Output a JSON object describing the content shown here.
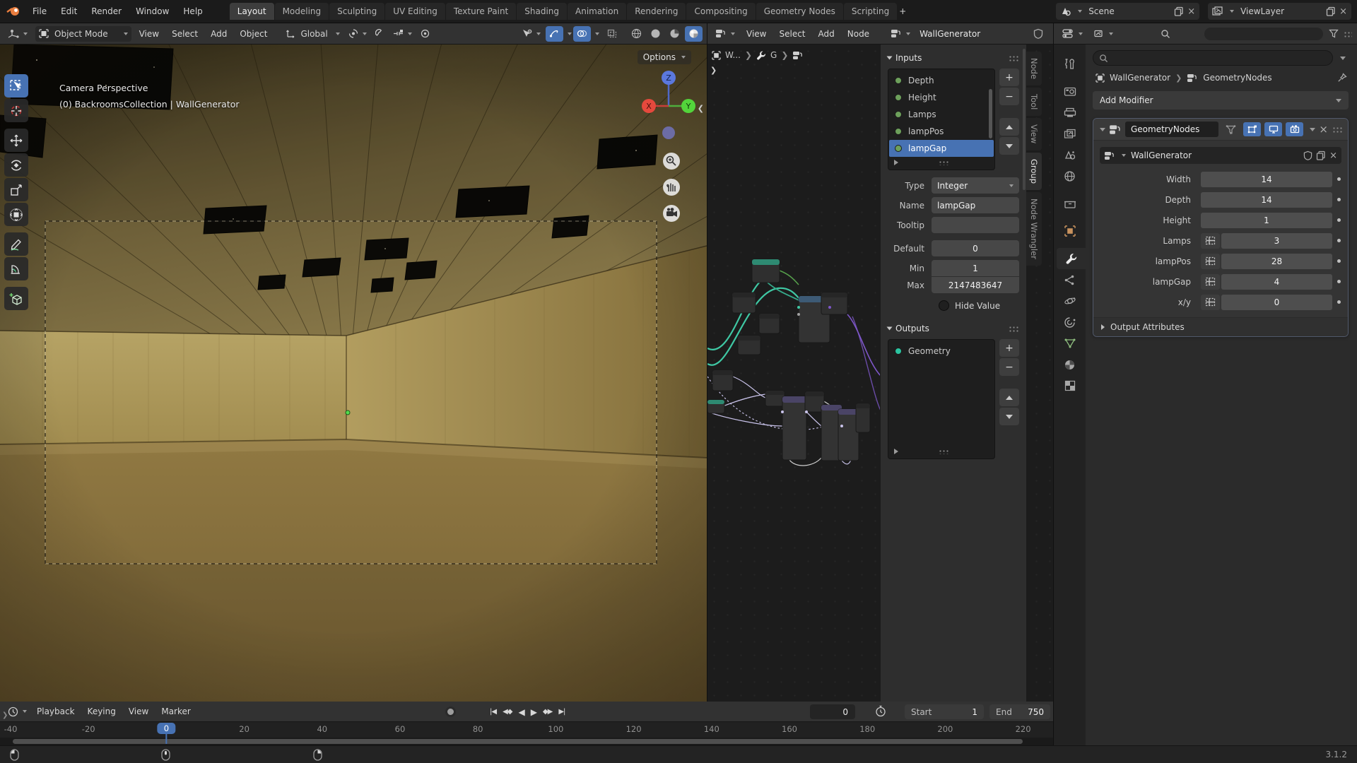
{
  "topbar": {
    "menus": [
      "File",
      "Edit",
      "Render",
      "Window",
      "Help"
    ],
    "workspaces": [
      {
        "label": "Layout",
        "active": true
      },
      {
        "label": "Modeling"
      },
      {
        "label": "Sculpting"
      },
      {
        "label": "UV Editing"
      },
      {
        "label": "Texture Paint"
      },
      {
        "label": "Shading"
      },
      {
        "label": "Animation"
      },
      {
        "label": "Rendering"
      },
      {
        "label": "Compositing"
      },
      {
        "label": "Geometry Nodes"
      },
      {
        "label": "Scripting"
      }
    ],
    "add_workspace": "+",
    "scene_label": "Scene",
    "view_layer_label": "ViewLayer"
  },
  "viewport": {
    "mode": "Object Mode",
    "menus": [
      "View",
      "Select",
      "Add",
      "Object"
    ],
    "orientation": "Global",
    "options_label": "Options",
    "overlay_line1": "Camera Perspective",
    "overlay_line2": "(0) BackroomsCollection | WallGenerator",
    "axis": {
      "x": "X",
      "y": "Y",
      "z": "Z"
    },
    "toolbar_icons": [
      "select-box",
      "cursor",
      "move",
      "rotate",
      "scale",
      "transform",
      "annotate",
      "measure",
      "add-cube"
    ]
  },
  "node_editor": {
    "menus": [
      "View",
      "Select",
      "Add",
      "Node"
    ],
    "tree_name": "WallGenerator",
    "breadcrumb": {
      "object": "W...",
      "modifier": "G"
    },
    "sidebar": {
      "inputs_title": "Inputs",
      "inputs": [
        {
          "label": "Depth"
        },
        {
          "label": "Height"
        },
        {
          "label": "Lamps"
        },
        {
          "label": "lampPos"
        },
        {
          "label": "lampGap",
          "selected": true
        }
      ],
      "fields": {
        "type_label": "Type",
        "type_value": "Integer",
        "name_label": "Name",
        "name_value": "lampGap",
        "tooltip_label": "Tooltip",
        "tooltip_value": "",
        "default_label": "Default",
        "default_value": "0",
        "min_label": "Min",
        "min_value": "1",
        "max_label": "Max",
        "max_value": "2147483647",
        "hide_value_label": "Hide Value"
      },
      "outputs_title": "Outputs",
      "outputs": [
        {
          "label": "Geometry"
        }
      ],
      "tabs": [
        {
          "label": "Node"
        },
        {
          "label": "Tool"
        },
        {
          "label": "View"
        },
        {
          "label": "Group",
          "active": true
        },
        {
          "label": "Node Wrangler"
        }
      ]
    }
  },
  "properties": {
    "breadcrumb": {
      "object": "WallGenerator",
      "modifier": "GeometryNodes"
    },
    "add_modifier_label": "Add Modifier",
    "tab_icons": [
      "tool",
      "render",
      "output",
      "view-layer",
      "scene",
      "world",
      "collection",
      "object",
      "modifiers",
      "particles",
      "physics",
      "constraints",
      "object-data",
      "material",
      "texture"
    ],
    "modifier": {
      "name": "GeometryNodes",
      "node_group": "WallGenerator",
      "params": [
        {
          "label": "Width",
          "value": "14"
        },
        {
          "label": "Depth",
          "value": "14"
        },
        {
          "label": "Height",
          "value": "1"
        },
        {
          "label": "Lamps",
          "value": "3",
          "toggle": true
        },
        {
          "label": "lampPos",
          "value": "28",
          "toggle": true
        },
        {
          "label": "lampGap",
          "value": "4",
          "toggle": true
        },
        {
          "label": "x/y",
          "value": "0",
          "toggle": true
        }
      ],
      "output_attributes_label": "Output Attributes"
    }
  },
  "timeline": {
    "menus": [
      "Playback",
      "Keying",
      "View",
      "Marker"
    ],
    "current_frame": "0",
    "start_label": "Start",
    "start_value": "1",
    "end_label": "End",
    "end_value": "750",
    "ruler_ticks": [
      {
        "value": "-40"
      },
      {
        "value": "-20"
      },
      {
        "value": "0",
        "playhead": true
      },
      {
        "value": "20"
      },
      {
        "value": "40"
      },
      {
        "value": "60"
      },
      {
        "value": "80"
      },
      {
        "value": "100"
      },
      {
        "value": "120"
      },
      {
        "value": "140"
      },
      {
        "value": "160"
      },
      {
        "value": "180"
      },
      {
        "value": "200"
      },
      {
        "value": "220"
      }
    ]
  },
  "status_bar": {
    "version": "3.1.2"
  },
  "colors": {
    "accent": "#4772b3",
    "socket_integer": "#6da05b",
    "socket_geometry": "#2bc4a0",
    "wire_teal": "#3fc8a4",
    "wire_purple": "#7e57c9",
    "wire_lavender": "#c9c3ea"
  }
}
